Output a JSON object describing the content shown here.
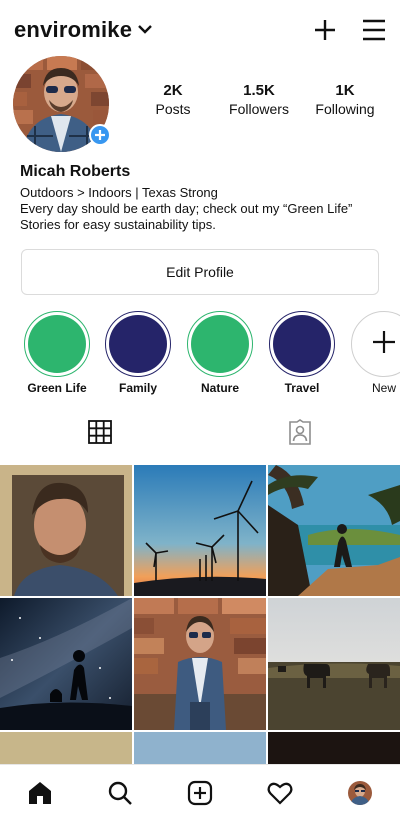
{
  "header": {
    "username": "enviromike",
    "icons": [
      "chevron-down-icon",
      "plus-icon",
      "menu-icon"
    ]
  },
  "profile": {
    "stats": [
      {
        "value": "2K",
        "label": "Posts"
      },
      {
        "value": "1.5K",
        "label": "Followers"
      },
      {
        "value": "1K",
        "label": "Following"
      }
    ],
    "name": "Micah Roberts",
    "bio_lines": [
      "Outdoors > Indoors | Texas Strong",
      "Every day should be earth day; check out my “Green Life”",
      "Stories for easy sustainability tips."
    ],
    "edit_label": "Edit Profile"
  },
  "highlights": [
    {
      "label": "Green Life",
      "color": "#2db56e"
    },
    {
      "label": "Family",
      "color": "#252469"
    },
    {
      "label": "Nature",
      "color": "#2db56e"
    },
    {
      "label": "Travel",
      "color": "#252469"
    },
    {
      "label": "New",
      "icon": "plus-icon"
    }
  ],
  "tabs": [
    {
      "icon": "grid-icon"
    },
    {
      "icon": "tagged-icon"
    }
  ],
  "bottom_nav": [
    "home-icon",
    "search-icon",
    "new-post-icon",
    "heart-icon",
    "profile-avatar"
  ]
}
